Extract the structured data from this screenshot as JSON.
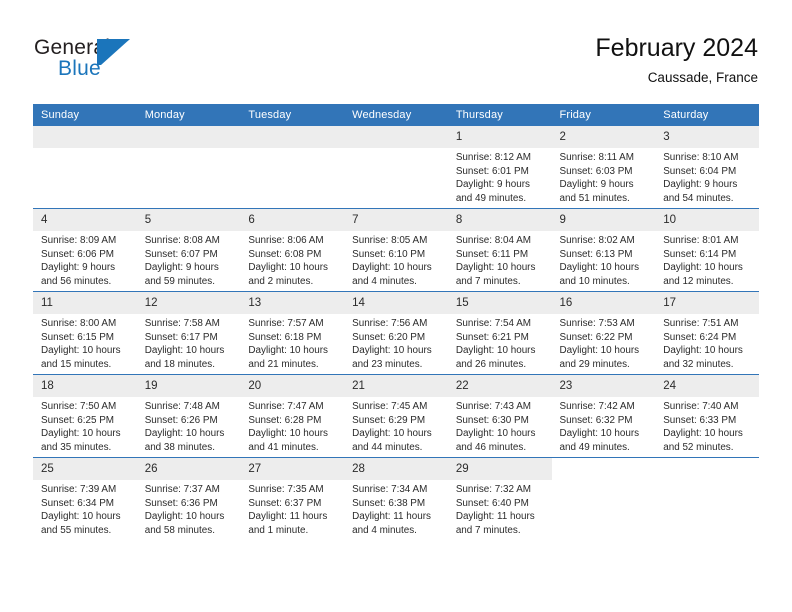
{
  "brand": {
    "name_top": "General",
    "name_bottom": "Blue",
    "mark": "triangle-flag-logo",
    "color_dark": "#231f20",
    "color_blue": "#1b75bb"
  },
  "header": {
    "title": "February 2024",
    "subtitle": "Caussade, France",
    "accent_color": "#3275b8"
  },
  "calendar": {
    "weekday_headers": [
      "Sunday",
      "Monday",
      "Tuesday",
      "Wednesday",
      "Thursday",
      "Friday",
      "Saturday"
    ],
    "weeks": [
      [
        {
          "day": "",
          "lines": []
        },
        {
          "day": "",
          "lines": []
        },
        {
          "day": "",
          "lines": []
        },
        {
          "day": "",
          "lines": []
        },
        {
          "day": "1",
          "lines": [
            "Sunrise: 8:12 AM",
            "Sunset: 6:01 PM",
            "Daylight: 9 hours",
            "and 49 minutes."
          ]
        },
        {
          "day": "2",
          "lines": [
            "Sunrise: 8:11 AM",
            "Sunset: 6:03 PM",
            "Daylight: 9 hours",
            "and 51 minutes."
          ]
        },
        {
          "day": "3",
          "lines": [
            "Sunrise: 8:10 AM",
            "Sunset: 6:04 PM",
            "Daylight: 9 hours",
            "and 54 minutes."
          ]
        }
      ],
      [
        {
          "day": "4",
          "lines": [
            "Sunrise: 8:09 AM",
            "Sunset: 6:06 PM",
            "Daylight: 9 hours",
            "and 56 minutes."
          ]
        },
        {
          "day": "5",
          "lines": [
            "Sunrise: 8:08 AM",
            "Sunset: 6:07 PM",
            "Daylight: 9 hours",
            "and 59 minutes."
          ]
        },
        {
          "day": "6",
          "lines": [
            "Sunrise: 8:06 AM",
            "Sunset: 6:08 PM",
            "Daylight: 10 hours",
            "and 2 minutes."
          ]
        },
        {
          "day": "7",
          "lines": [
            "Sunrise: 8:05 AM",
            "Sunset: 6:10 PM",
            "Daylight: 10 hours",
            "and 4 minutes."
          ]
        },
        {
          "day": "8",
          "lines": [
            "Sunrise: 8:04 AM",
            "Sunset: 6:11 PM",
            "Daylight: 10 hours",
            "and 7 minutes."
          ]
        },
        {
          "day": "9",
          "lines": [
            "Sunrise: 8:02 AM",
            "Sunset: 6:13 PM",
            "Daylight: 10 hours",
            "and 10 minutes."
          ]
        },
        {
          "day": "10",
          "lines": [
            "Sunrise: 8:01 AM",
            "Sunset: 6:14 PM",
            "Daylight: 10 hours",
            "and 12 minutes."
          ]
        }
      ],
      [
        {
          "day": "11",
          "lines": [
            "Sunrise: 8:00 AM",
            "Sunset: 6:15 PM",
            "Daylight: 10 hours",
            "and 15 minutes."
          ]
        },
        {
          "day": "12",
          "lines": [
            "Sunrise: 7:58 AM",
            "Sunset: 6:17 PM",
            "Daylight: 10 hours",
            "and 18 minutes."
          ]
        },
        {
          "day": "13",
          "lines": [
            "Sunrise: 7:57 AM",
            "Sunset: 6:18 PM",
            "Daylight: 10 hours",
            "and 21 minutes."
          ]
        },
        {
          "day": "14",
          "lines": [
            "Sunrise: 7:56 AM",
            "Sunset: 6:20 PM",
            "Daylight: 10 hours",
            "and 23 minutes."
          ]
        },
        {
          "day": "15",
          "lines": [
            "Sunrise: 7:54 AM",
            "Sunset: 6:21 PM",
            "Daylight: 10 hours",
            "and 26 minutes."
          ]
        },
        {
          "day": "16",
          "lines": [
            "Sunrise: 7:53 AM",
            "Sunset: 6:22 PM",
            "Daylight: 10 hours",
            "and 29 minutes."
          ]
        },
        {
          "day": "17",
          "lines": [
            "Sunrise: 7:51 AM",
            "Sunset: 6:24 PM",
            "Daylight: 10 hours",
            "and 32 minutes."
          ]
        }
      ],
      [
        {
          "day": "18",
          "lines": [
            "Sunrise: 7:50 AM",
            "Sunset: 6:25 PM",
            "Daylight: 10 hours",
            "and 35 minutes."
          ]
        },
        {
          "day": "19",
          "lines": [
            "Sunrise: 7:48 AM",
            "Sunset: 6:26 PM",
            "Daylight: 10 hours",
            "and 38 minutes."
          ]
        },
        {
          "day": "20",
          "lines": [
            "Sunrise: 7:47 AM",
            "Sunset: 6:28 PM",
            "Daylight: 10 hours",
            "and 41 minutes."
          ]
        },
        {
          "day": "21",
          "lines": [
            "Sunrise: 7:45 AM",
            "Sunset: 6:29 PM",
            "Daylight: 10 hours",
            "and 44 minutes."
          ]
        },
        {
          "day": "22",
          "lines": [
            "Sunrise: 7:43 AM",
            "Sunset: 6:30 PM",
            "Daylight: 10 hours",
            "and 46 minutes."
          ]
        },
        {
          "day": "23",
          "lines": [
            "Sunrise: 7:42 AM",
            "Sunset: 6:32 PM",
            "Daylight: 10 hours",
            "and 49 minutes."
          ]
        },
        {
          "day": "24",
          "lines": [
            "Sunrise: 7:40 AM",
            "Sunset: 6:33 PM",
            "Daylight: 10 hours",
            "and 52 minutes."
          ]
        }
      ],
      [
        {
          "day": "25",
          "lines": [
            "Sunrise: 7:39 AM",
            "Sunset: 6:34 PM",
            "Daylight: 10 hours",
            "and 55 minutes."
          ]
        },
        {
          "day": "26",
          "lines": [
            "Sunrise: 7:37 AM",
            "Sunset: 6:36 PM",
            "Daylight: 10 hours",
            "and 58 minutes."
          ]
        },
        {
          "day": "27",
          "lines": [
            "Sunrise: 7:35 AM",
            "Sunset: 6:37 PM",
            "Daylight: 11 hours",
            "and 1 minute."
          ]
        },
        {
          "day": "28",
          "lines": [
            "Sunrise: 7:34 AM",
            "Sunset: 6:38 PM",
            "Daylight: 11 hours",
            "and 4 minutes."
          ]
        },
        {
          "day": "29",
          "lines": [
            "Sunrise: 7:32 AM",
            "Sunset: 6:40 PM",
            "Daylight: 11 hours",
            "and 7 minutes."
          ]
        },
        {
          "day": "",
          "lines": []
        },
        {
          "day": "",
          "lines": []
        }
      ]
    ]
  }
}
